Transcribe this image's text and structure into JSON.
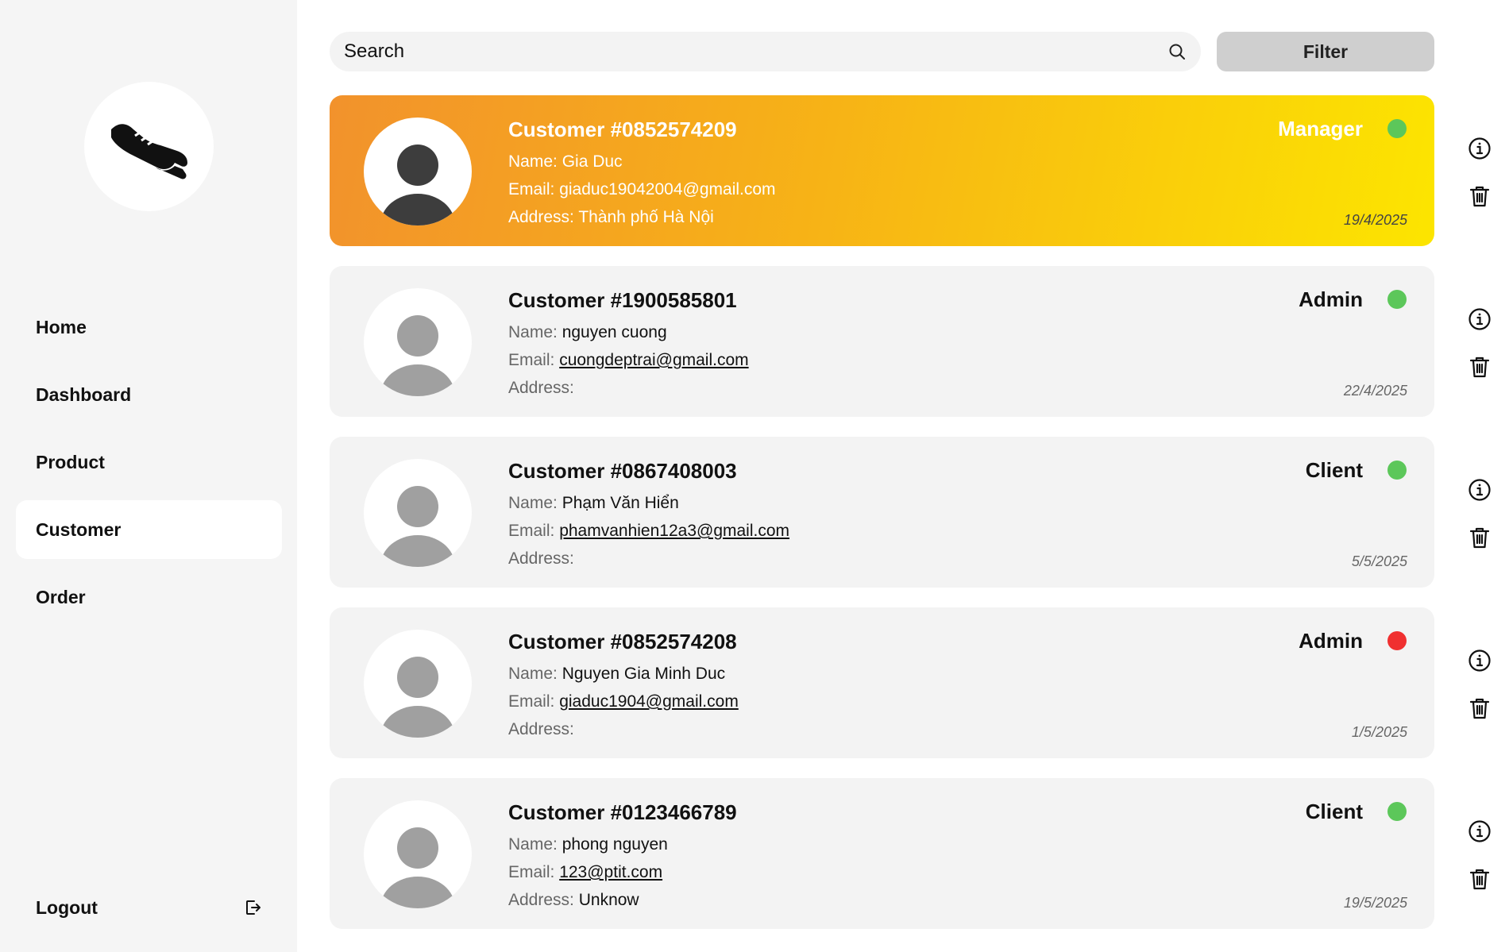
{
  "sidebar": {
    "logo_icon": "sneaker-icon",
    "items": [
      {
        "label": "Home",
        "active": false
      },
      {
        "label": "Dashboard",
        "active": false
      },
      {
        "label": "Product",
        "active": false
      },
      {
        "label": "Customer",
        "active": true
      },
      {
        "label": "Order",
        "active": false
      }
    ],
    "logout_label": "Logout",
    "logout_icon": "logout-icon"
  },
  "search": {
    "placeholder": "Search",
    "value": "",
    "icon": "search-icon"
  },
  "filter_label": "Filter",
  "colors": {
    "active_status": "#5cc75a",
    "inactive_status": "#f03030",
    "highlight_start": "#f2922c",
    "highlight_end": "#fce500"
  },
  "customers": [
    {
      "title": "Customer #0852574209",
      "name_label": "Name:",
      "name": "Gia Duc",
      "email_label": "Email:",
      "email": "giaduc19042004@gmail.com",
      "address_label": "Address:",
      "address": "Thành phố Hà Nội",
      "role": "Manager",
      "status": "active",
      "date": "19/4/2025",
      "highlight": true
    },
    {
      "title": "Customer #1900585801",
      "name_label": "Name:",
      "name": "nguyen cuong",
      "email_label": "Email:",
      "email": "cuongdeptrai@gmail.com",
      "address_label": "Address:",
      "address": "",
      "role": "Admin",
      "status": "active",
      "date": "22/4/2025",
      "highlight": false
    },
    {
      "title": "Customer #0867408003",
      "name_label": "Name:",
      "name": "Phạm Văn Hiển",
      "email_label": "Email:",
      "email": "phamvanhien12a3@gmail.com",
      "address_label": "Address:",
      "address": "",
      "role": "Client",
      "status": "active",
      "date": "5/5/2025",
      "highlight": false
    },
    {
      "title": "Customer #0852574208",
      "name_label": "Name:",
      "name": "Nguyen Gia Minh Duc",
      "email_label": "Email:",
      "email": "giaduc1904@gmail.com",
      "address_label": "Address:",
      "address": "",
      "role": "Admin",
      "status": "inactive",
      "date": "1/5/2025",
      "highlight": false
    },
    {
      "title": "Customer #0123466789",
      "name_label": "Name:",
      "name": "phong nguyen",
      "email_label": "Email:",
      "email": "123@ptit.com",
      "address_label": "Address:",
      "address": "Unknow",
      "role": "Client",
      "status": "active",
      "date": "19/5/2025",
      "highlight": false
    }
  ]
}
